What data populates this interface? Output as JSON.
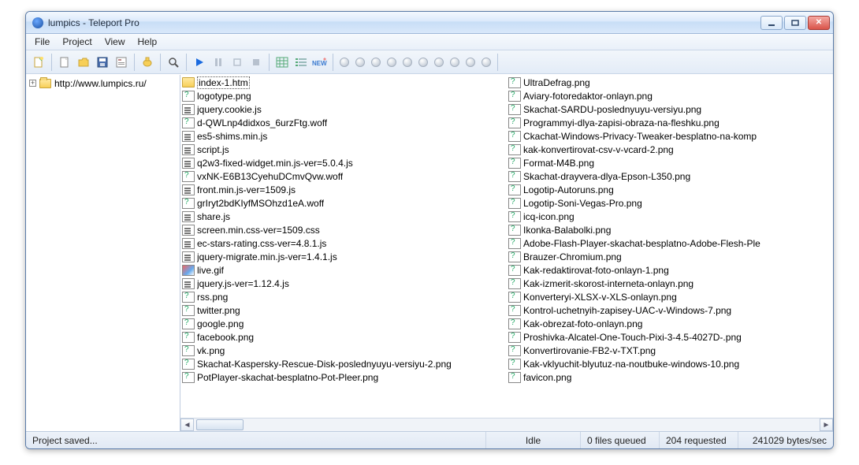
{
  "title": "lumpics - Teleport Pro",
  "menus": [
    "File",
    "Project",
    "View",
    "Help"
  ],
  "tree": {
    "root": "http://www.lumpics.ru/"
  },
  "files_col1": [
    {
      "name": "index-1.htm",
      "icon": "folder-open",
      "selected": true
    },
    {
      "name": "logotype.png",
      "icon": "q"
    },
    {
      "name": "jquery.cookie.js",
      "icon": "js"
    },
    {
      "name": "d-QWLnp4didxos_6urzFtg.woff",
      "icon": "q"
    },
    {
      "name": "es5-shims.min.js",
      "icon": "js"
    },
    {
      "name": "script.js",
      "icon": "js"
    },
    {
      "name": "q2w3-fixed-widget.min.js-ver=5.0.4.js",
      "icon": "js"
    },
    {
      "name": "vxNK-E6B13CyehuDCmvQvw.woff",
      "icon": "q"
    },
    {
      "name": "front.min.js-ver=1509.js",
      "icon": "js"
    },
    {
      "name": "grIryt2bdKIyfMSOhzd1eA.woff",
      "icon": "q"
    },
    {
      "name": "share.js",
      "icon": "js"
    },
    {
      "name": "screen.min.css-ver=1509.css",
      "icon": "js"
    },
    {
      "name": "ec-stars-rating.css-ver=4.8.1.js",
      "icon": "js"
    },
    {
      "name": "jquery-migrate.min.js-ver=1.4.1.js",
      "icon": "js"
    },
    {
      "name": "live.gif",
      "icon": "gif"
    },
    {
      "name": "jquery.js-ver=1.12.4.js",
      "icon": "js"
    },
    {
      "name": "rss.png",
      "icon": "q"
    },
    {
      "name": "twitter.png",
      "icon": "q"
    },
    {
      "name": "google.png",
      "icon": "q"
    },
    {
      "name": "facebook.png",
      "icon": "q"
    },
    {
      "name": "vk.png",
      "icon": "q"
    },
    {
      "name": "Skachat-Kaspersky-Rescue-Disk-poslednyuyu-versiyu-2.png",
      "icon": "q"
    },
    {
      "name": "PotPlayer-skachat-besplatno-Pot-Pleer.png",
      "icon": "q"
    }
  ],
  "files_col2": [
    {
      "name": "UltraDefrag.png",
      "icon": "q"
    },
    {
      "name": "Aviary-fotoredaktor-onlayn.png",
      "icon": "q"
    },
    {
      "name": "Skachat-SARDU-poslednyuyu-versiyu.png",
      "icon": "q"
    },
    {
      "name": "Programmyi-dlya-zapisi-obraza-na-fleshku.png",
      "icon": "q"
    },
    {
      "name": "Ckachat-Windows-Privacy-Tweaker-besplatno-na-komp",
      "icon": "q"
    },
    {
      "name": "kak-konvertirovat-csv-v-vcard-2.png",
      "icon": "q"
    },
    {
      "name": "Format-M4B.png",
      "icon": "q"
    },
    {
      "name": "Skachat-drayvera-dlya-Epson-L350.png",
      "icon": "q"
    },
    {
      "name": "Logotip-Autoruns.png",
      "icon": "q"
    },
    {
      "name": "Logotip-Soni-Vegas-Pro.png",
      "icon": "q"
    },
    {
      "name": "icq-icon.png",
      "icon": "q"
    },
    {
      "name": "Ikonka-Balabolki.png",
      "icon": "q"
    },
    {
      "name": "Adobe-Flash-Player-skachat-besplatno-Adobe-Flesh-Ple",
      "icon": "q"
    },
    {
      "name": "Brauzer-Chromium.png",
      "icon": "q"
    },
    {
      "name": "Kak-redaktirovat-foto-onlayn-1.png",
      "icon": "q"
    },
    {
      "name": "Kak-izmerit-skorost-interneta-onlayn.png",
      "icon": "q"
    },
    {
      "name": "Konverteryi-XLSX-v-XLS-onlayn.png",
      "icon": "q"
    },
    {
      "name": "Kontrol-uchetnyih-zapisey-UAC-v-Windows-7.png",
      "icon": "q"
    },
    {
      "name": "Kak-obrezat-foto-onlayn.png",
      "icon": "q"
    },
    {
      "name": "Proshivka-Alcatel-One-Touch-Pixi-3-4.5-4027D-.png",
      "icon": "q"
    },
    {
      "name": "Konvertirovanie-FB2-v-TXT.png",
      "icon": "q"
    },
    {
      "name": "Kak-vklyuchit-blyutuz-na-noutbuke-windows-10.png",
      "icon": "q"
    },
    {
      "name": "favicon.png",
      "icon": "q"
    }
  ],
  "status": {
    "left": "Project saved...",
    "state": "Idle",
    "queued": "0 files queued",
    "requested": "204 requested",
    "rate": "241029 bytes/sec"
  }
}
